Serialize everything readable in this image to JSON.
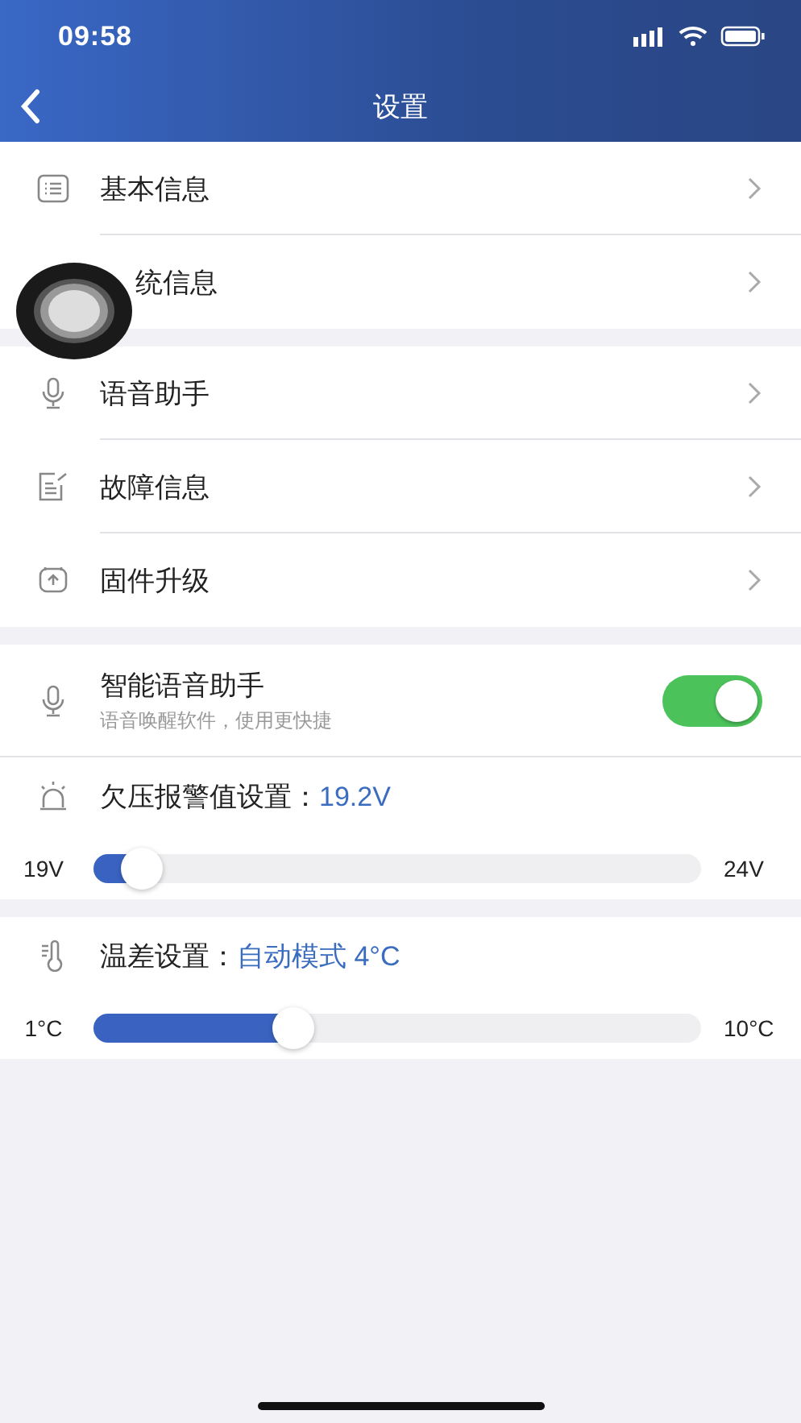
{
  "status_bar": {
    "time": "09:58"
  },
  "nav_bar": {
    "title": "设置"
  },
  "groups": [
    {
      "items": [
        {
          "kind": "nav",
          "label": "基本信息"
        },
        {
          "kind": "nav",
          "label": "统信息"
        }
      ]
    },
    {
      "items": [
        {
          "kind": "nav",
          "label": "语音助手"
        },
        {
          "kind": "nav",
          "label": "故障信息"
        },
        {
          "kind": "nav",
          "label": "固件升级"
        }
      ]
    },
    {
      "items": [
        {
          "kind": "toggle",
          "label": "智能语音助手",
          "subtitle": "语音唤醒软件，使用更快捷",
          "on": true
        },
        {
          "kind": "slider",
          "label": "欠压报警值设置：",
          "value": "19.2V",
          "min_label": "19V",
          "max_label": "24V",
          "level": 0.08
        }
      ]
    },
    {
      "items": [
        {
          "kind": "slider",
          "label": "温差设置：",
          "value": "自动模式 4°C",
          "min_label": "1°C",
          "max_label": "10°C",
          "level": 0.33
        }
      ]
    }
  ],
  "floating_button": {
    "kind": "assistive-touch"
  }
}
